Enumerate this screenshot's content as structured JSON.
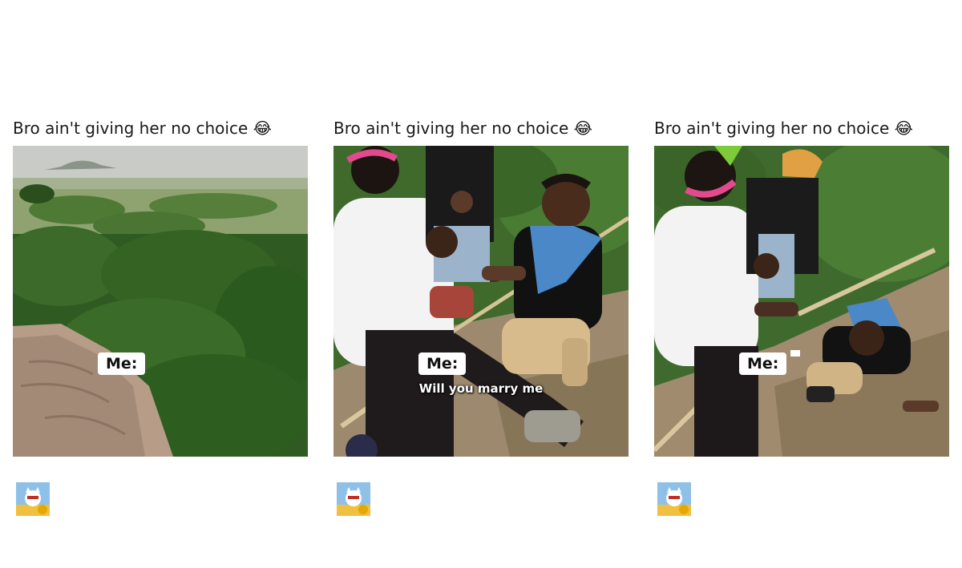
{
  "panels": [
    {
      "caption": "Bro ain't giving her no choice",
      "caption_emoji": "😂",
      "overlay_label": "Me:",
      "subtitle": ""
    },
    {
      "caption": "Bro ain't giving her no choice",
      "caption_emoji": "😂",
      "overlay_label": "Me:",
      "subtitle": "Will you marry me"
    },
    {
      "caption": "Bro ain't giving her no choice",
      "caption_emoji": "😂",
      "overlay_label": "Me:",
      "subtitle": ""
    }
  ],
  "icons": {
    "caption_emoji": "laughing-crying-emoji",
    "avatar": "cartoon-cat-avatar-icon"
  },
  "colors": {
    "background": "#ffffff",
    "caption_text": "#1a1a1a",
    "label_bg": "#ffffff"
  }
}
